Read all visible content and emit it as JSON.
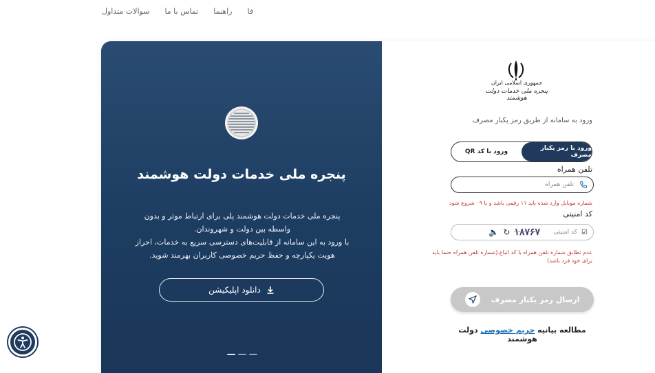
{
  "topnav": {
    "items": [
      "فا",
      "راهنما",
      "تماس با ما",
      "سوالات متداول"
    ]
  },
  "left": {
    "title": "پنجره ملی خدمات دولت هوشمند",
    "desc_line1": "پنجره ملی خدمات دولت هوشمند پلی برای ارتباط موثر و بدون",
    "desc_line2": "واسطه بین دولت و شهروندان.",
    "desc_line3": "با ورود به این سامانه از قابلیت‌های دسترسی سریع به خدمات، احراز",
    "desc_line4": "هویت یکپارچه و حفظ حریم خصوصی کاربران بهرمند شوید.",
    "download_label": "دانلود اپلیکیشن"
  },
  "right": {
    "emblem_line1": "جمهوری اسلامی ایران",
    "emblem_line2": "پنجره ملی خدمات دولت هوشمند",
    "login_sub": "ورود به سامانه از طریق رمز یکبار مصرف",
    "tab_otp": "ورود با رمز یکبار مصرف",
    "tab_qr": "ورود با کد QR",
    "phone_label": "تلفن همراه",
    "phone_placeholder": "تلفن همراه",
    "phone_error": "شماره موبایل وارد شده باید ۱۱ رقمی باشد و با ۰۹ شروع شود",
    "captcha_label": "کد امنیتی",
    "captcha_placeholder": "کد امنیتی",
    "captcha_code": "۱۸۷۶۷",
    "match_error": "عدم تطابق شماره تلفن همراه با کد اتباع.(شماره تلفن همراه حتما باید برای خود فرد باشد)",
    "submit_label": "ارسال رمز یکبار مصرف",
    "privacy_prefix": "مطالعه بیانیه",
    "privacy_link": "حریم خصوصی",
    "privacy_suffix": "دولت هوشمند"
  },
  "colors": {
    "panel_blue": "#1f3a5c",
    "error_red": "#c0392b",
    "link_blue": "#1a6fb3",
    "disabled_gray": "#c8c8c8"
  }
}
